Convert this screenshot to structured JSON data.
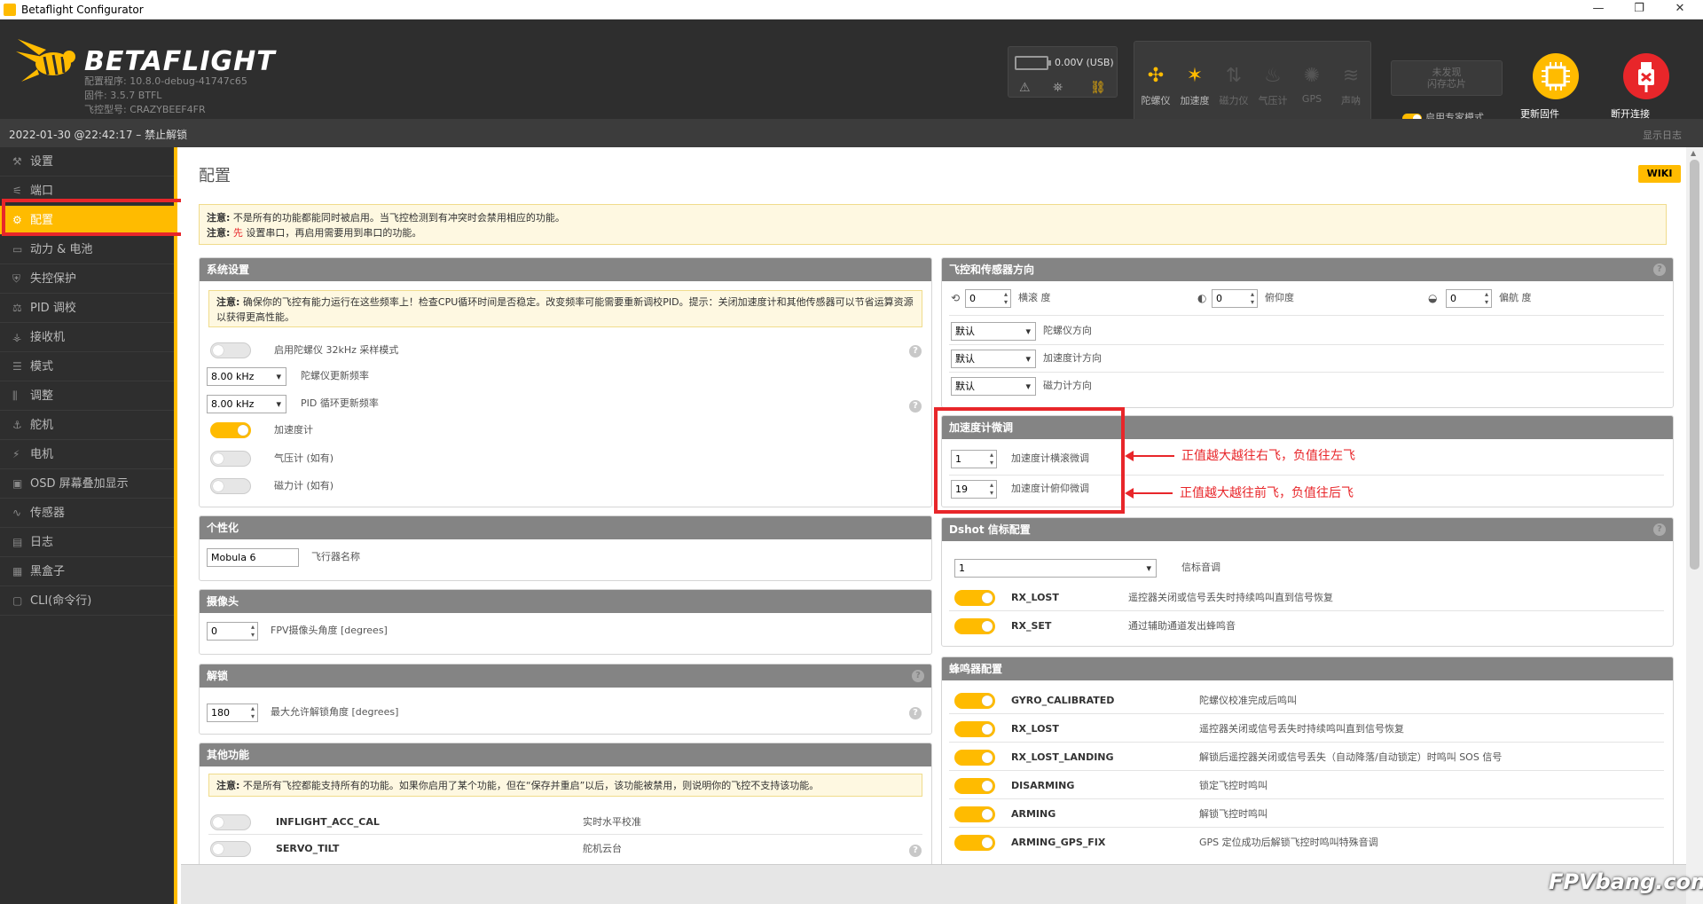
{
  "window": {
    "title": "Betaflight Configurator",
    "minimize": "—",
    "restore": "❐",
    "close": "✕"
  },
  "header": {
    "brand": "BETAFLIGHT",
    "configurator_version": "配置程序: 10.8.0-debug-41747c65",
    "firmware": "固件: 3.5.7 BTFL",
    "fc_model": "飞控型号: CRAZYBEEF4FR",
    "battery_voltage": "0.00V (USB)",
    "sensors": [
      {
        "label": "陀螺仪",
        "icon": "gyro-icon",
        "glyph": "✣",
        "active": true
      },
      {
        "label": "加速度",
        "icon": "accel-icon",
        "glyph": "✶",
        "active": true
      },
      {
        "label": "磁力仪",
        "icon": "mag-icon",
        "glyph": "⇅",
        "active": false
      },
      {
        "label": "气压计",
        "icon": "baro-icon",
        "glyph": "♨",
        "active": false
      },
      {
        "label": "GPS",
        "icon": "gps-icon",
        "glyph": "✺",
        "active": false
      },
      {
        "label": "声呐",
        "icon": "sonar-icon",
        "glyph": "≋",
        "active": false
      }
    ],
    "dataflash_line1": "未发现",
    "dataflash_line2": "闪存芯片",
    "expert_mode": "启用专家模式",
    "update_firmware": "更新固件",
    "disconnect": "断开连接"
  },
  "status": {
    "datetime": "2022-01-30 @22:42:17 – 禁止解锁",
    "show_log": "显示日志"
  },
  "sidebar": [
    {
      "label": "设置",
      "icon": "wrench-icon",
      "glyph": "⚒"
    },
    {
      "label": "端口",
      "icon": "plug-icon",
      "glyph": "⚟"
    },
    {
      "label": "配置",
      "icon": "gear-icon",
      "glyph": "⚙",
      "active": true
    },
    {
      "label": "动力 & 电池",
      "icon": "battery-icon",
      "glyph": "▭"
    },
    {
      "label": "失控保护",
      "icon": "failsafe-icon",
      "glyph": "⛨"
    },
    {
      "label": "PID 调校",
      "icon": "pid-icon",
      "glyph": "⚖"
    },
    {
      "label": "接收机",
      "icon": "receiver-icon",
      "glyph": "⚶"
    },
    {
      "label": "模式",
      "icon": "modes-icon",
      "glyph": "☰"
    },
    {
      "label": "调整",
      "icon": "adjust-icon",
      "glyph": "⫼"
    },
    {
      "label": "舵机",
      "icon": "servo-icon",
      "glyph": "⚓"
    },
    {
      "label": "电机",
      "icon": "motor-icon",
      "glyph": "⚡"
    },
    {
      "label": "OSD 屏幕叠加显示",
      "icon": "osd-icon",
      "glyph": "▣"
    },
    {
      "label": "传感器",
      "icon": "sensors-icon",
      "glyph": "∿"
    },
    {
      "label": "日志",
      "icon": "log-icon",
      "glyph": "▤"
    },
    {
      "label": "黑盒子",
      "icon": "blackbox-icon",
      "glyph": "▦"
    },
    {
      "label": "CLI(命令行)",
      "icon": "cli-icon",
      "glyph": "▢"
    }
  ],
  "page": {
    "title": "配置",
    "wiki": "WIKI",
    "notice1_label": "注意:",
    "notice1": " 不是所有的功能都能同时被启用。当飞控检测到有冲突时会禁用相应的功能。",
    "notice2_label": "注意:",
    "notice2_red": " 先",
    "notice2": " 设置串口，再启用需要用到串口的功能。"
  },
  "system": {
    "title": "系统设置",
    "warn_label": "注意:",
    "warn": " 确保你的飞控有能力运行在这些频率上！检查CPU循环时间是否稳定。改变频率可能需要重新调校PID。提示：关闭加速度计和其他传感器可以节省运算资源以获得更高性能。",
    "gyro32": "启用陀螺仪 32kHz 采样模式",
    "gyro_rate": "8.00 kHz",
    "gyro_rate_label": "陀螺仪更新频率",
    "pid_rate": "8.00 kHz",
    "pid_rate_label": "PID 循环更新频率",
    "accel": "加速度计",
    "baro": "气压计 (如有)",
    "mag": "磁力计 (如有)"
  },
  "personal": {
    "title": "个性化",
    "craft_name": "Mobula 6",
    "craft_name_label": "飞行器名称"
  },
  "camera": {
    "title": "摄像头",
    "angle": "0",
    "angle_label": "FPV摄像头角度 [degrees]"
  },
  "arming": {
    "title": "解锁",
    "angle": "180",
    "angle_label": "最大允许解锁角度 [degrees]"
  },
  "other": {
    "title": "其他功能",
    "warn_label": "注意:",
    "warn": " 不是所有飞控都能支持所有的功能。如果你启用了某个功能，但在“保存并重启”以后，该功能被禁用，则说明你的飞控不支持该功能。",
    "items": [
      {
        "name": "INFLIGHT_ACC_CAL",
        "desc": "实时水平校准"
      },
      {
        "name": "SERVO_TILT",
        "desc": "舵机云台"
      }
    ]
  },
  "board": {
    "title": "飞控和传感器方向",
    "roll": "0",
    "roll_label": "横滚 度",
    "pitch": "0",
    "pitch_label": "俯仰度",
    "yaw": "0",
    "yaw_label": "偏航 度",
    "gyro_align": "默认",
    "gyro_align_label": "陀螺仪方向",
    "acc_align": "默认",
    "acc_align_label": "加速度计方向",
    "mag_align": "默认",
    "mag_align_label": "磁力计方向"
  },
  "acc_trim": {
    "title": "加速度计微调",
    "roll": "1",
    "roll_label": "加速度计横滚微调",
    "pitch": "19",
    "pitch_label": "加速度计俯仰微调"
  },
  "annotations": {
    "roll": "正值越大越往右飞，负值往左飞",
    "pitch": "正值越大越往前飞，负值往后飞"
  },
  "dshot": {
    "title": "Dshot 信标配置",
    "tone": "1",
    "tone_label": "信标音调",
    "items": [
      {
        "name": "RX_LOST",
        "desc": "遥控器关闭或信号丢失时持续鸣叫直到信号恢复"
      },
      {
        "name": "RX_SET",
        "desc": "通过辅助通道发出蜂鸣音"
      }
    ]
  },
  "beeper": {
    "title": "蜂鸣器配置",
    "items": [
      {
        "name": "GYRO_CALIBRATED",
        "desc": "陀螺仪校准完成后鸣叫"
      },
      {
        "name": "RX_LOST",
        "desc": "遥控器关闭或信号丢失时持续鸣叫直到信号恢复"
      },
      {
        "name": "RX_LOST_LANDING",
        "desc": "解锁后遥控器关闭或信号丢失（自动降落/自动锁定）时鸣叫 SOS 信号"
      },
      {
        "name": "DISARMING",
        "desc": "锁定飞控时鸣叫"
      },
      {
        "name": "ARMING",
        "desc": "解锁飞控时鸣叫"
      },
      {
        "name": "ARMING_GPS_FIX",
        "desc": "GPS 定位成功后解锁飞控时鸣叫特殊音调"
      }
    ]
  },
  "watermark": "FPVbang.com",
  "colors": {
    "accent": "#ffbb00",
    "highlight": "#e8262a",
    "header": "#2e2e2e"
  }
}
